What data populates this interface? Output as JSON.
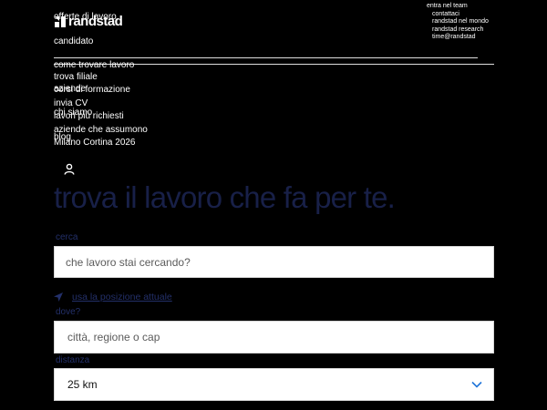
{
  "brand": {
    "name": "randstad"
  },
  "header": {
    "offerte": "offerte di lavoro",
    "candidato": "candidato",
    "utility": [
      "entra nel team",
      "contattaci",
      "randstad nel mondo",
      "randstad research",
      "time@randstad"
    ]
  },
  "nav": {
    "items": [
      "come trovare lavoro",
      "trova filiale",
      "corsi di formazione",
      "aziende",
      "invia CV",
      "chi siamo",
      "lavori più richiesti",
      "aziende che assumono",
      "blog",
      "Milano Cortina 2026"
    ]
  },
  "hero": {
    "title": "trova il lavoro che fa per te."
  },
  "search": {
    "cerca_label": "cerca",
    "cerca_placeholder": "che lavoro stai cercando?",
    "geo_link": "usa la posizione attuale",
    "dove_label": "dove?",
    "dove_placeholder": "città, regione o cap",
    "distanza_label": "distanza",
    "distanza_value": "25 km"
  },
  "colors": {
    "hero": "#182048",
    "label": "#23306a",
    "accent": "#2175d9"
  }
}
